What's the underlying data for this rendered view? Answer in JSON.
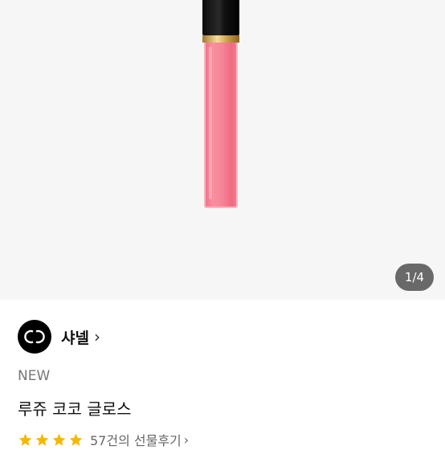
{
  "gallery": {
    "counter": "1/4"
  },
  "brand": {
    "name": "샤넬",
    "chevron": "›",
    "logo_icon": "chanel-logo"
  },
  "product": {
    "badge": "NEW",
    "title": "루쥬 코코 글로스"
  },
  "rating": {
    "stars": 4,
    "star_color": "#f5b800",
    "review_text": "57건의 선물후기",
    "chevron": "›"
  }
}
